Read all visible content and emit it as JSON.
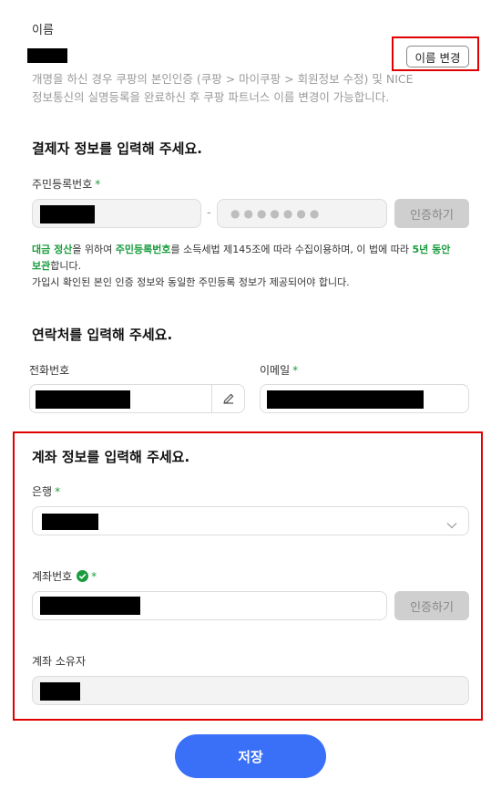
{
  "name_section": {
    "label": "이름",
    "change_button": "이름 변경",
    "help_line1": "개명을 하신 경우 쿠팡의 본인인증 (쿠팡 > 마이쿠팡 > 회원정보 수정) 및 NICE",
    "help_line2": "정보통신의 실명등록을 완료하신 후 쿠팡 파트너스 이름 변경이 가능합니다."
  },
  "payer_section": {
    "heading": "결제자 정보를 입력해 주세요.",
    "rrn_label": "주민등록번호",
    "required_mark": "*",
    "rrn_separator": "-",
    "rrn_back_mask": "●●●●●●●",
    "verify_button": "인증하기",
    "notice": {
      "part1": "대금 정산",
      "part2": "을 위하여 ",
      "part3": "주민등록번호",
      "part4": "를 소득세법 제145조에 따라 수집이용하며, 이 법에 따라 ",
      "part5": "5년 동안",
      "part6": "보관",
      "part7": "합니다.",
      "line2": "가입시 확인된 본인 인증 정보와 동일한 주민등록 정보가 제공되어야 합니다."
    }
  },
  "contact_section": {
    "heading": "연락처를 입력해 주세요.",
    "phone_label": "전화번호",
    "email_label": "이메일",
    "required_mark": "*"
  },
  "account_section": {
    "heading": "계좌 정보를 입력해 주세요.",
    "bank_label": "은행",
    "account_label": "계좌번호",
    "verify_button": "인증하기",
    "holder_label": "계좌 소유자",
    "required_mark": "*"
  },
  "save_button": "저장",
  "colors": {
    "accent_blue": "#3a6ff7",
    "required_green": "#1a9c3e",
    "highlight_red": "#e00000"
  }
}
